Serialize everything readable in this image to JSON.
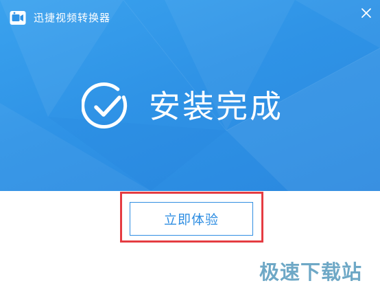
{
  "window": {
    "title": "迅捷视频转换器",
    "app_icon": "camera-app-icon",
    "close_icon": "close-icon"
  },
  "main": {
    "status_text": "安装完成",
    "status_icon": "check-circle-icon",
    "button_label": "立即体验"
  },
  "watermark": {
    "text": "极速下载站"
  },
  "colors": {
    "header_blue": "#2f93e6",
    "button_blue": "#2f8ee2",
    "highlight_red": "#e53c42",
    "watermark_blue": "#5f9fc0"
  }
}
